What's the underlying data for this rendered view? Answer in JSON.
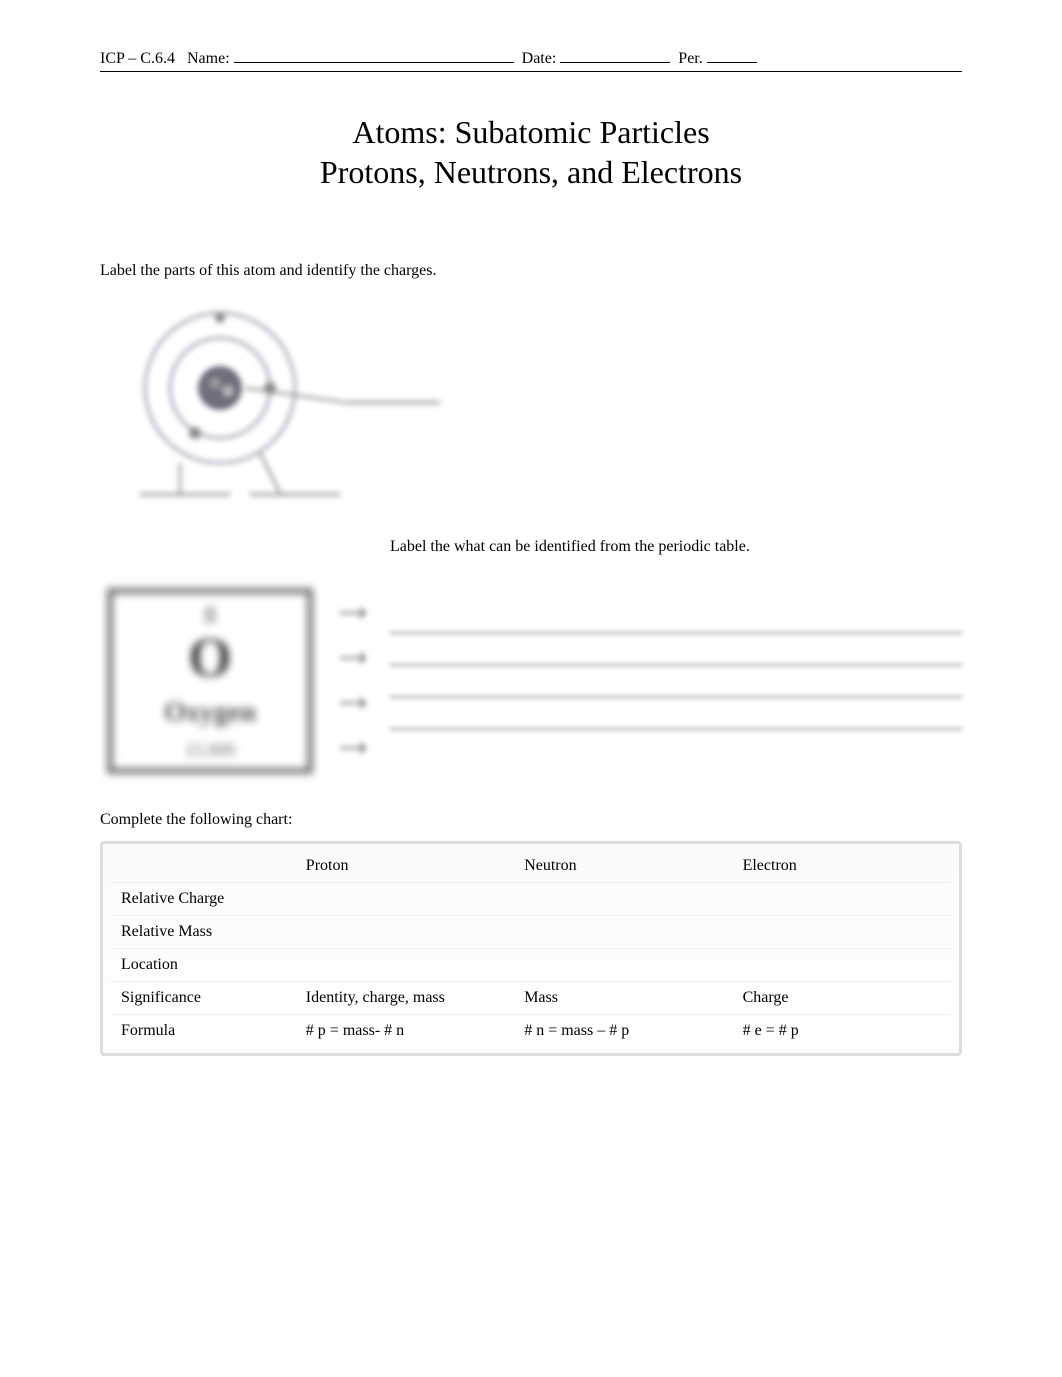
{
  "header": {
    "course": "ICP – C.6.4",
    "name_label": "Name:",
    "date_label": "Date:",
    "per_label": "Per."
  },
  "title": {
    "line1": "Atoms: Subatomic Particles",
    "line2": "Protons, Neutrons, and Electrons"
  },
  "instructions": {
    "atom_label": "Label the parts of this atom and identify the charges.",
    "periodic_label": "Label the what can be identified from the periodic table.",
    "chart_label": "Complete the following chart:"
  },
  "periodic_box": {
    "number": "8",
    "symbol": "O",
    "name": "Oxygen",
    "mass": "15.999"
  },
  "chart": {
    "headers": [
      "",
      "Proton",
      "Neutron",
      "Electron"
    ],
    "rows": [
      {
        "label": "Relative Charge",
        "proton": "",
        "neutron": "",
        "electron": ""
      },
      {
        "label": "Relative Mass",
        "proton": "",
        "neutron": "",
        "electron": ""
      },
      {
        "label": "Location",
        "proton": "",
        "neutron": "",
        "electron": ""
      },
      {
        "label": "Significance",
        "proton": "Identity, charge, mass",
        "neutron": "Mass",
        "electron": "Charge"
      },
      {
        "label": "Formula",
        "proton": "# p = mass- # n",
        "neutron": "# n = mass – # p",
        "electron": "# e = # p"
      }
    ]
  }
}
